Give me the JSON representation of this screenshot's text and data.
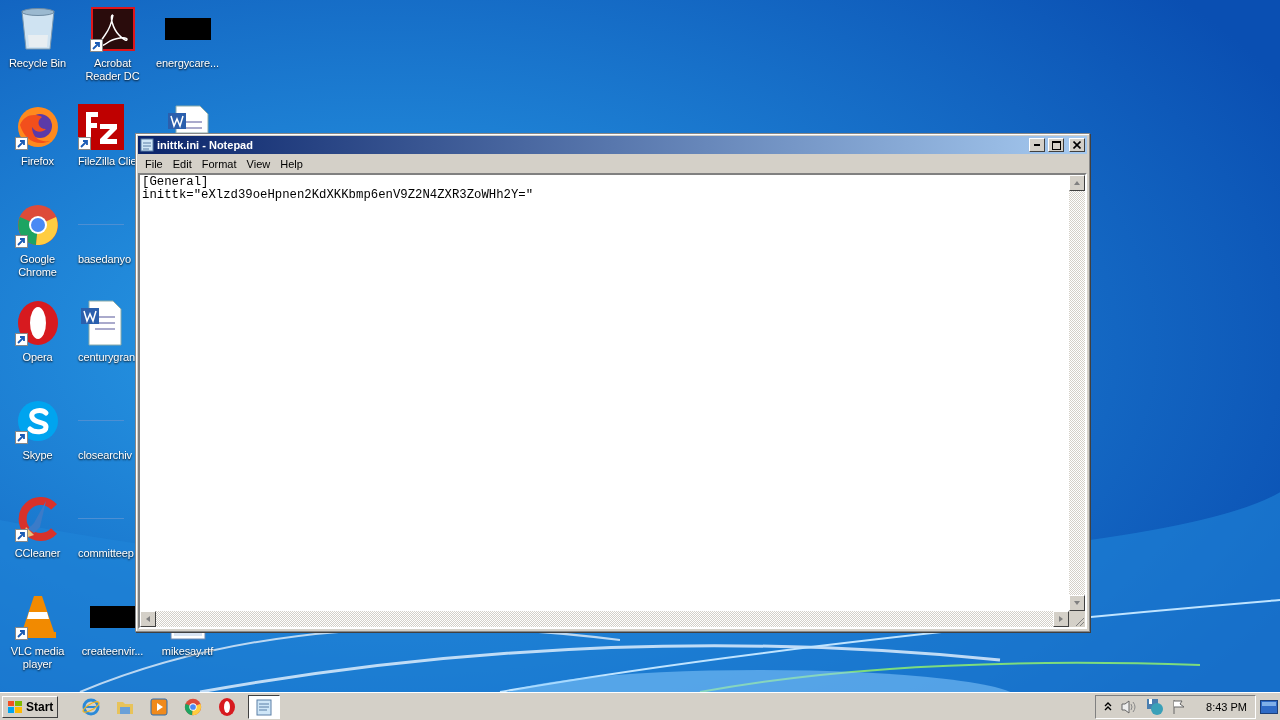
{
  "desktop": {
    "columns": [
      [
        {
          "label": "Recycle Bin",
          "kind": "recycle-bin",
          "shortcut": false
        },
        {
          "label": "Firefox",
          "kind": "firefox",
          "shortcut": true
        },
        {
          "label": "Google Chrome",
          "kind": "chrome",
          "shortcut": true
        },
        {
          "label": "Opera",
          "kind": "opera",
          "shortcut": true
        },
        {
          "label": "Skype",
          "kind": "skype",
          "shortcut": true
        },
        {
          "label": "CCleaner",
          "kind": "ccleaner",
          "shortcut": true
        },
        {
          "label": "VLC media player",
          "kind": "vlc",
          "shortcut": true
        }
      ],
      [
        {
          "label": "Acrobat Reader DC",
          "kind": "acrobat",
          "shortcut": true
        },
        {
          "label": "FileZilla Clie",
          "kind": "filezilla",
          "shortcut": true
        },
        {
          "label": "basedanyo",
          "kind": "blank",
          "shortcut": false
        },
        {
          "label": "centurygran",
          "kind": "word-doc",
          "shortcut": false
        },
        {
          "label": "closearchiv",
          "kind": "blank",
          "shortcut": false
        },
        {
          "label": "committeep",
          "kind": "blank",
          "shortcut": false
        },
        {
          "label": "createenvir...",
          "kind": "redacted",
          "shortcut": false
        }
      ],
      [
        {
          "label": "energycare...",
          "kind": "redacted",
          "shortcut": false
        },
        {
          "kind": "word-doc-top"
        },
        {
          "label": "mikesay.rtf",
          "kind": "document"
        }
      ]
    ]
  },
  "window": {
    "title": "inittk.ini - Notepad",
    "active": true,
    "menu": [
      "File",
      "Edit",
      "Format",
      "View",
      "Help"
    ],
    "lines": [
      "[General]",
      "inittk=\"eXlzd39oeHpnen2KdXKKbmp6enV9Z2N4ZXR3ZoWHh2Y=\""
    ]
  },
  "taskbar": {
    "start": "Start",
    "pinned": [
      {
        "kind": "ie"
      },
      {
        "kind": "explorer"
      },
      {
        "kind": "media-player"
      },
      {
        "kind": "chrome"
      },
      {
        "kind": "opera"
      }
    ],
    "tasks": [
      {
        "kind": "notepad",
        "selected": true
      }
    ],
    "tray": [
      {
        "kind": "chevron"
      },
      {
        "kind": "speaker"
      },
      {
        "kind": "network"
      },
      {
        "kind": "flag"
      }
    ],
    "clock": "8:43 PM"
  }
}
